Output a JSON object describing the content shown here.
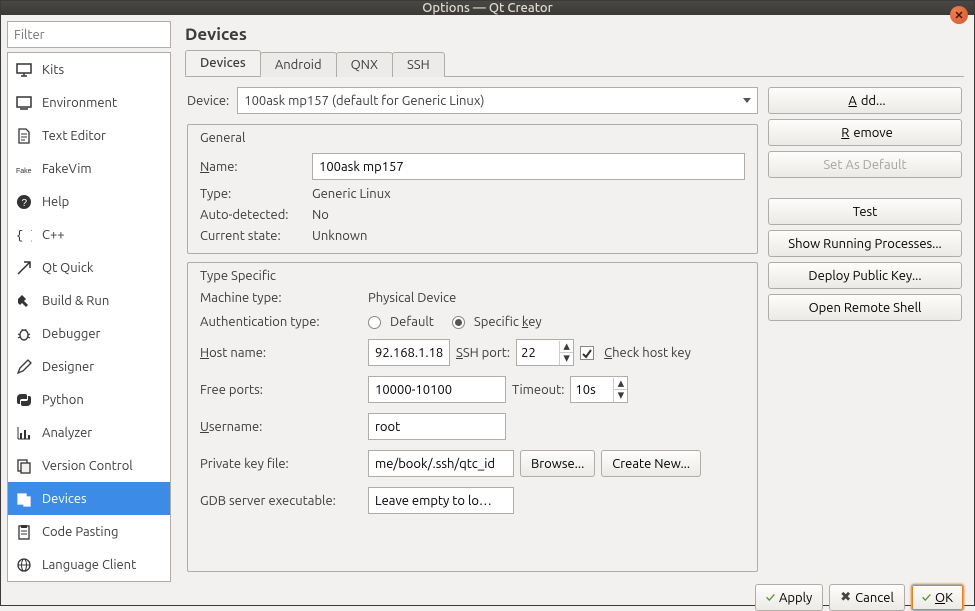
{
  "window": {
    "title": "Options — Qt Creator"
  },
  "filter": {
    "placeholder": "Filter"
  },
  "categories": [
    {
      "id": "kits",
      "label": "Kits"
    },
    {
      "id": "environment",
      "label": "Environment"
    },
    {
      "id": "texteditor",
      "label": "Text Editor"
    },
    {
      "id": "fakevim",
      "label": "FakeVim"
    },
    {
      "id": "help",
      "label": "Help"
    },
    {
      "id": "cpp",
      "label": "C++"
    },
    {
      "id": "qtquick",
      "label": "Qt Quick"
    },
    {
      "id": "buildrun",
      "label": "Build & Run"
    },
    {
      "id": "debugger",
      "label": "Debugger"
    },
    {
      "id": "designer",
      "label": "Designer"
    },
    {
      "id": "python",
      "label": "Python"
    },
    {
      "id": "analyzer",
      "label": "Analyzer"
    },
    {
      "id": "versioncontrol",
      "label": "Version Control"
    },
    {
      "id": "devices",
      "label": "Devices"
    },
    {
      "id": "codepasting",
      "label": "Code Pasting"
    },
    {
      "id": "languageclient",
      "label": "Language Client"
    }
  ],
  "heading": "Devices",
  "tabs": [
    {
      "id": "devices",
      "label": "Devices"
    },
    {
      "id": "android",
      "label": "Android"
    },
    {
      "id": "qnx",
      "label": "QNX"
    },
    {
      "id": "ssh",
      "label": "SSH"
    }
  ],
  "deviceRow": {
    "label": "Device:",
    "value": "100ask mp157 (default for Generic Linux)"
  },
  "general": {
    "title": "General",
    "name_label": "Name:",
    "name_u": "N",
    "name": "100ask mp157",
    "type_label": "Type:",
    "type": "Generic Linux",
    "auto_label": "Auto-detected:",
    "auto": "No",
    "state_label": "Current state:",
    "state": "Unknown"
  },
  "typeSpecific": {
    "title": "Type Specific",
    "machine_label": "Machine type:",
    "machine": "Physical Device",
    "auth_label": "Authentication type:",
    "default_opt": "Default",
    "specific_pre": "Specific ",
    "specific_u": "k",
    "specific_post": "ey",
    "host_pre": "",
    "host_u": "H",
    "host_post": "ost name:",
    "host": "92.168.1.18",
    "sshport_pre": "",
    "sshport_u": "S",
    "sshport_post": "SH port:",
    "sshport": "22",
    "checkhost_pre": "",
    "checkhost_u": "C",
    "checkhost_post": "heck host key",
    "freeports_label": "Free ports:",
    "freeports": "10000-10100",
    "timeout_label": "Timeout:",
    "timeout": "10s",
    "username_pre": "",
    "username_u": "U",
    "username_post": "sername:",
    "username": "root",
    "pkey_label": "Private key file:",
    "pkey": "me/book/.ssh/qtc_id",
    "browse": "Browse...",
    "createnew": "Create New...",
    "gdb_label": "GDB server executable:",
    "gdb": "Leave empty to lo…"
  },
  "rightButtons": {
    "add_pre": "",
    "add_u": "A",
    "add_post": "dd...",
    "remove_pre": "",
    "remove_u": "R",
    "remove_post": "emove",
    "setdefault": "Set As Default",
    "test": "Test",
    "procs": "Show Running Processes...",
    "deploy": "Deploy Public Key...",
    "remote": "Open Remote Shell"
  },
  "bottom": {
    "apply": "Apply",
    "cancel": "Cancel",
    "ok_pre": "",
    "ok_u": "O",
    "ok_post": "K"
  }
}
